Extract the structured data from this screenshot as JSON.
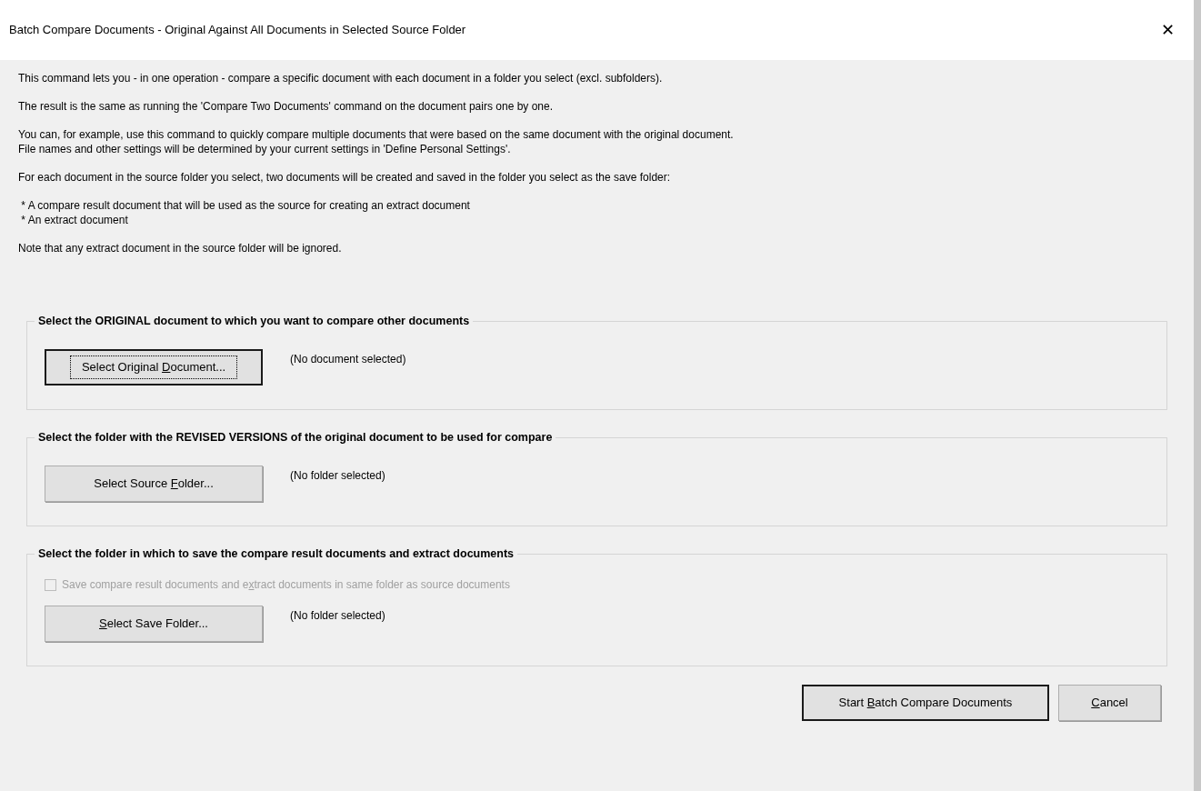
{
  "window": {
    "title": "Batch Compare Documents - Original Against All Documents in Selected Source Folder",
    "close": "✕"
  },
  "intro": [
    {
      "lines": [
        "This command lets you - in one operation - compare a specific document with each document in a folder you select (excl. subfolders)."
      ]
    },
    {
      "lines": [
        "The result is the same as running the 'Compare Two Documents' command on the document pairs one by one."
      ]
    },
    {
      "lines": [
        "You can, for example, use this command to quickly compare multiple documents that were based on the same document with the original document.",
        "File names and other settings will be determined by your current settings in 'Define Personal Settings'."
      ]
    },
    {
      "lines": [
        "For each document in the source folder you select, two documents will be created and saved in the folder you select as the save folder:"
      ]
    },
    {
      "lines": [
        " * A compare result document that will be used as the source for creating an extract document",
        " * An extract document"
      ]
    },
    {
      "lines": [
        "Note that any extract document in the source folder will be ignored."
      ]
    }
  ],
  "groups": [
    {
      "title": "Select the ORIGINAL document to which you want to compare other documents",
      "button": {
        "pre": "Select Original ",
        "key": "D",
        "post": "ocument...",
        "focused": true
      },
      "status": "(No document selected)"
    },
    {
      "title": "Select the folder with the REVISED VERSIONS of the original document to be used for compare",
      "button": {
        "pre": "Select Source ",
        "key": "F",
        "post": "older...",
        "focused": false
      },
      "status": "(No folder selected)"
    },
    {
      "title": "Select the folder in which to save the compare result documents and extract documents",
      "checkbox": {
        "pre": "Save compare result documents and e",
        "key": "x",
        "post": "tract documents in same folder as source documents",
        "checked": false,
        "disabled": true
      },
      "button": {
        "key": "S",
        "post": "elect Save Folder...",
        "focused": false
      },
      "status": "(No folder selected)"
    }
  ],
  "footer": [
    {
      "pre": "Start ",
      "key": "B",
      "post": "atch Compare Documents",
      "default": true
    },
    {
      "key": "C",
      "post": "ancel",
      "default": false
    }
  ]
}
